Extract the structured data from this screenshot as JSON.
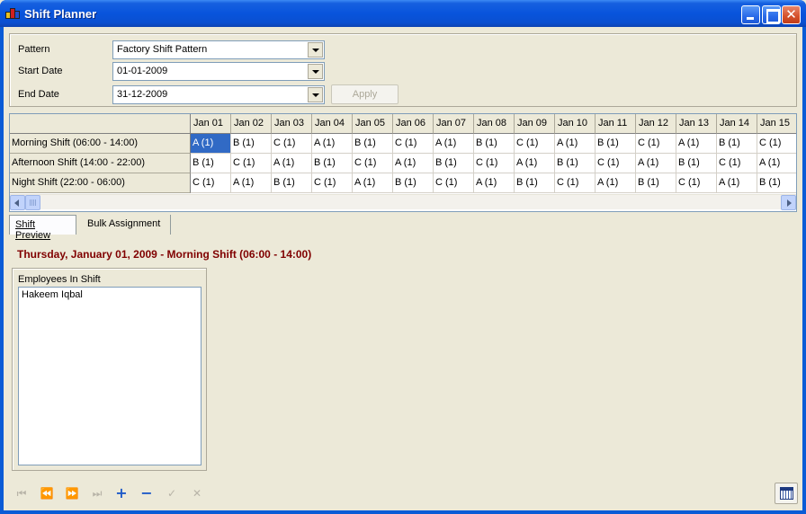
{
  "window": {
    "title": "Shift Planner"
  },
  "form": {
    "pattern_label": "Pattern",
    "pattern_value": "Factory Shift Pattern",
    "start_label": "Start Date",
    "start_value": "01-01-2009",
    "end_label": "End Date",
    "end_value": "31-12-2009",
    "apply_label": "Apply"
  },
  "grid": {
    "columns": [
      "Jan 01",
      "Jan 02",
      "Jan 03",
      "Jan 04",
      "Jan 05",
      "Jan 06",
      "Jan 07",
      "Jan 08",
      "Jan 09",
      "Jan 10",
      "Jan 11",
      "Jan 12",
      "Jan 13",
      "Jan 14",
      "Jan 15"
    ],
    "rows": [
      {
        "label": "Morning Shift (06:00 - 14:00)",
        "cells": [
          "A (1)",
          "B (1)",
          "C (1)",
          "A (1)",
          "B (1)",
          "C (1)",
          "A (1)",
          "B (1)",
          "C (1)",
          "A (1)",
          "B (1)",
          "C (1)",
          "A (1)",
          "B (1)",
          "C (1)"
        ]
      },
      {
        "label": "Afternoon Shift (14:00 - 22:00)",
        "cells": [
          "B (1)",
          "C (1)",
          "A (1)",
          "B (1)",
          "C (1)",
          "A (1)",
          "B (1)",
          "C (1)",
          "A (1)",
          "B (1)",
          "C (1)",
          "A (1)",
          "B (1)",
          "C (1)",
          "A (1)"
        ]
      },
      {
        "label": "Night Shift (22:00 - 06:00)",
        "cells": [
          "C (1)",
          "A (1)",
          "B (1)",
          "C (1)",
          "A (1)",
          "B (1)",
          "C (1)",
          "A (1)",
          "B (1)",
          "C (1)",
          "A (1)",
          "B (1)",
          "C (1)",
          "A (1)",
          "B (1)"
        ]
      }
    ],
    "selected": {
      "row": 0,
      "col": 0
    }
  },
  "tabs": [
    {
      "label": "Shift Preview",
      "active": true
    },
    {
      "label": "Bulk Assignment",
      "active": false
    }
  ],
  "preview": {
    "title": "Thursday, January 01, 2009 - Morning Shift (06:00 - 14:00)",
    "employees_label": "Employees In Shift",
    "employees": [
      "Hakeem Iqbal"
    ]
  },
  "navigator": {
    "icons": [
      "first-icon",
      "prev-icon",
      "next-icon",
      "last-icon",
      "add-icon",
      "remove-icon",
      "confirm-icon",
      "cancel-icon"
    ],
    "accent": "#1E5AC8"
  }
}
